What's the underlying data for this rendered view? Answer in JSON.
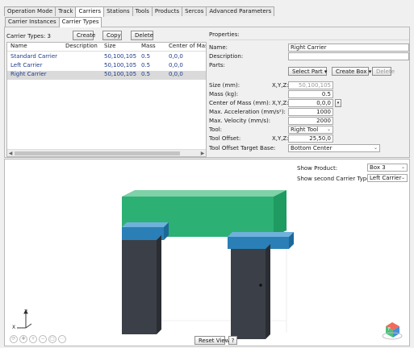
{
  "main_tabs": [
    "Operation Mode",
    "Track",
    "Carriers",
    "Stations",
    "Tools",
    "Products",
    "Sercos",
    "Advanced Parameters"
  ],
  "main_tab_active": 2,
  "sub_tabs": [
    "Carrier Instances",
    "Carrier Types"
  ],
  "sub_tab_active": 1,
  "carrier_types": {
    "count_label": "Carrier Types: 3",
    "create_label": "Create",
    "copy_label": "Copy",
    "delete_label": "Delete",
    "columns": [
      "Name",
      "Description",
      "Size",
      "Mass",
      "Center of Mass: M"
    ],
    "rows": [
      {
        "name": "Standard Carrier",
        "description": "",
        "size": "50,100,105",
        "mass": "0.5",
        "com": "0,0,0"
      },
      {
        "name": "Left Carrier",
        "description": "",
        "size": "50,100,105",
        "mass": "0.5",
        "com": "0,0,0"
      },
      {
        "name": "Right Carrier",
        "description": "",
        "size": "50,100,105",
        "mass": "0.5",
        "com": "0,0,0"
      }
    ],
    "selected_row": 2
  },
  "properties": {
    "title": "Properties:",
    "name_label": "Name:",
    "name_value": "Right Carrier",
    "description_label": "Description:",
    "description_value": "",
    "parts_label": "Parts:",
    "select_part_label": "Select Part",
    "create_box_label": "Create Box",
    "parts_delete_label": "Delete",
    "size_label": "Size (mm):",
    "size_xyz": "X,Y,Z:",
    "size_value": "50,100,105",
    "mass_label": "Mass (kg):",
    "mass_value": "0.5",
    "com_label": "Center of Mass (mm):",
    "com_xyz": "X,Y,Z:",
    "com_value": "0,0,0",
    "accel_label": "Max. Acceleration (mm/s²):",
    "accel_value": "1000",
    "vel_label": "Max. Velocity (mm/s):",
    "vel_value": "2000",
    "tool_label": "Tool:",
    "tool_value": "Right Tool",
    "tool_offset_label": "Tool Offset:",
    "tool_offset_xyz": "X,Y,Z:",
    "tool_offset_value": "25,50,0",
    "tool_base_label": "Tool Offset Target Base:",
    "tool_base_value": "Bottom Center"
  },
  "viewport": {
    "show_product_label": "Show Product:",
    "show_product_value": "Box 3",
    "show_second_label": "Show second Carrier Type:",
    "show_second_value": "Left Carrier",
    "reset_view_label": "Reset View",
    "help_label": "?",
    "axis_z": "Z",
    "axis_x": "X",
    "cube_label": "F"
  },
  "colors": {
    "product_green": "#2db074",
    "tool_blue": "#2a7fb6",
    "carrier_dark": "#3b3f47"
  }
}
